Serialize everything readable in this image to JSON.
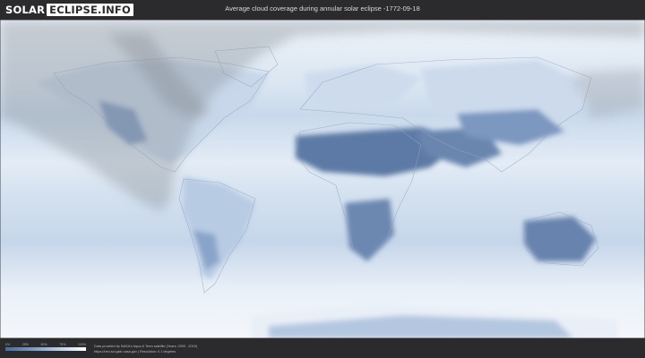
{
  "header": {
    "logo_part1": "SOLAR",
    "logo_part2": "ECLIPSE.INFO",
    "title": "Average cloud coverage during annular solar eclipse -1772-09-18"
  },
  "legend": {
    "scale_labels": [
      "0%",
      "25%",
      "50%",
      "75%",
      "100%"
    ],
    "colors": {
      "clear": "#4a6b99",
      "cloudy": "#ffffff"
    }
  },
  "footer": {
    "credit_line1": "Data provided by NASA's Aqua & Terra satellite (Years: 2000 - 2019)",
    "credit_line2": "https://neo.sci.gsfc.nasa.gov | Resolution: 0.1 degrees"
  },
  "colors": {
    "background": "#2b2b2d",
    "map_base": "#dfe8f3",
    "cloudless": "#5a78a3",
    "eclipse_shade": "#9aa0a8"
  }
}
